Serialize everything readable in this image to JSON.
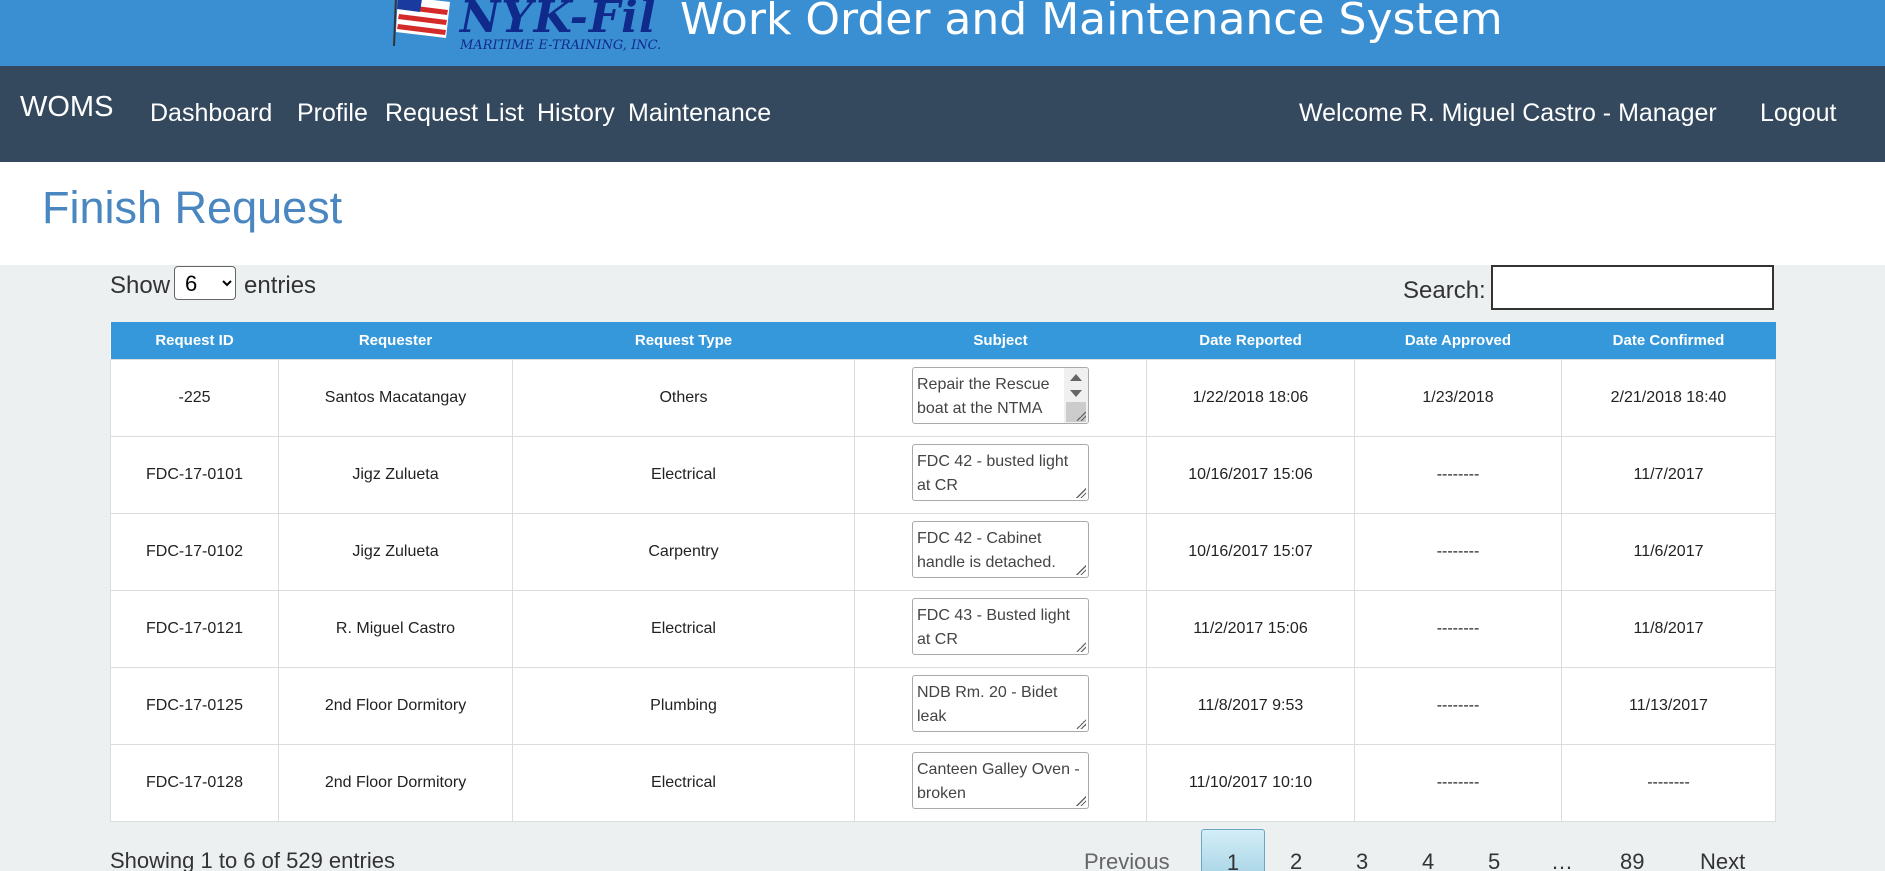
{
  "banner": {
    "logo_text": "NYK-Fil",
    "logo_subtext": "MARITIME E-TRAINING, INC.",
    "title": "Work Order and Maintenance System"
  },
  "navbar": {
    "brand": "WOMS",
    "items": [
      {
        "label": "Dashboard"
      },
      {
        "label": "Profile"
      },
      {
        "label": "Request List"
      },
      {
        "label": "History"
      },
      {
        "label": "Maintenance"
      }
    ],
    "welcome": "Welcome R. Miguel Castro - Manager",
    "logout": "Logout"
  },
  "page": {
    "title": "Finish Request"
  },
  "controls": {
    "show_label": "Show",
    "entries_value": "6",
    "entries_label": "entries",
    "search_label": "Search:",
    "search_value": ""
  },
  "table": {
    "headers": [
      "Request ID",
      "Requester",
      "Request Type",
      "Subject",
      "Date Reported",
      "Date Approved",
      "Date Confirmed"
    ],
    "rows": [
      {
        "id": "-225",
        "requester": "Santos Macatangay",
        "type": "Others",
        "subject": "Repair the Rescue boat at the NTMA",
        "reported": "1/22/2018 18:06",
        "approved": "1/23/2018",
        "confirmed": "2/21/2018 18:40"
      },
      {
        "id": "FDC-17-0101",
        "requester": "Jigz Zulueta",
        "type": "Electrical",
        "subject": "FDC 42 - busted light at CR",
        "reported": "10/16/2017 15:06",
        "approved": "--------",
        "confirmed": "11/7/2017"
      },
      {
        "id": "FDC-17-0102",
        "requester": "Jigz Zulueta",
        "type": "Carpentry",
        "subject": "FDC 42 - Cabinet handle is detached.",
        "reported": "10/16/2017 15:07",
        "approved": "--------",
        "confirmed": "11/6/2017"
      },
      {
        "id": "FDC-17-0121",
        "requester": "R. Miguel Castro",
        "type": "Electrical",
        "subject": "FDC 43 - Busted light at CR",
        "reported": "11/2/2017 15:06",
        "approved": "--------",
        "confirmed": "11/8/2017"
      },
      {
        "id": "FDC-17-0125",
        "requester": "2nd Floor Dormitory",
        "type": "Plumbing",
        "subject": "NDB Rm. 20 - Bidet leak",
        "reported": "11/8/2017 9:53",
        "approved": "--------",
        "confirmed": "11/13/2017"
      },
      {
        "id": "FDC-17-0128",
        "requester": "2nd Floor Dormitory",
        "type": "Electrical",
        "subject": "Canteen Galley Oven - broken",
        "reported": "11/10/2017 10:10",
        "approved": "--------",
        "confirmed": "--------"
      }
    ]
  },
  "footer": {
    "info": "Showing 1 to 6 of 529 entries",
    "previous": "Previous",
    "pages": [
      "1",
      "2",
      "3",
      "4",
      "5",
      "…",
      "89"
    ],
    "next": "Next"
  }
}
